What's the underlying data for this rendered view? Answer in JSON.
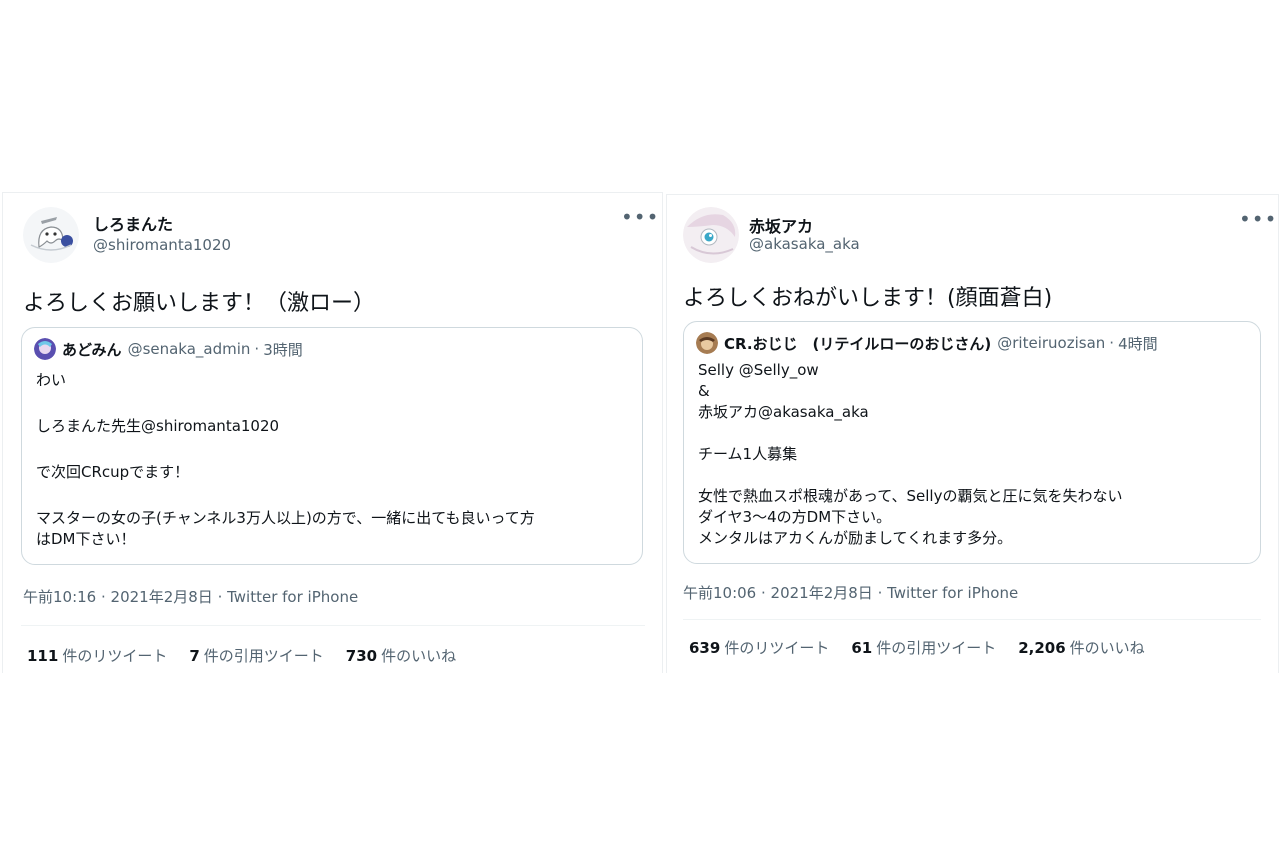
{
  "left": {
    "name": "しろまんた",
    "handle": "@shiromanta1020",
    "more": "•••",
    "text": "よろしくお願いします！（激ロー）",
    "quote": {
      "name": "あどみん",
      "handle": "@senaka_admin",
      "sep": "·",
      "time": "3時間",
      "lines": [
        "わい",
        "",
        "しろまんた先生@shiromanta1020",
        "",
        "で次回CRcupでます！",
        "",
        "マスターの女の子(チャンネル3万人以上)の方で、一緒に出ても良いって方",
        "はDM下さい！"
      ]
    },
    "time": "午前10:16 · 2021年2月8日",
    "sep": " · ",
    "source": "Twitter for iPhone",
    "stats": [
      {
        "count": "111",
        "label": "件のリツイート"
      },
      {
        "count": "7",
        "label": "件の引用ツイート"
      },
      {
        "count": "730",
        "label": "件のいいね"
      }
    ]
  },
  "right": {
    "name": "赤坂アカ",
    "handle": "@akasaka_aka",
    "more": "•••",
    "text": "よろしくおねがいします！(顔面蒼白)",
    "quote": {
      "name": "CR.おじじ　(リテイルローのおじさん)",
      "handle": "@riteiruozisan",
      "sep": "·",
      "time": "4時間",
      "lines": [
        "Selly @Selly_ow",
        "&",
        "赤坂アカ@akasaka_aka",
        "",
        "チーム1人募集",
        "",
        "女性で熱血スポ根魂があって、Sellyの覇気と圧に気を失わない",
        "ダイヤ3～4の方DM下さい。",
        "メンタルはアカくんが励ましてくれます多分。"
      ]
    },
    "time": "午前10:06 · 2021年2月8日",
    "sep": " · ",
    "source": "Twitter for iPhone",
    "stats": [
      {
        "count": "639",
        "label": "件のリツイート"
      },
      {
        "count": "61",
        "label": "件の引用ツイート"
      },
      {
        "count": "2,206",
        "label": "件のいいね"
      }
    ]
  },
  "colors": {
    "text": "#0f1419",
    "muted": "#536471",
    "border": "#cfd9de"
  }
}
